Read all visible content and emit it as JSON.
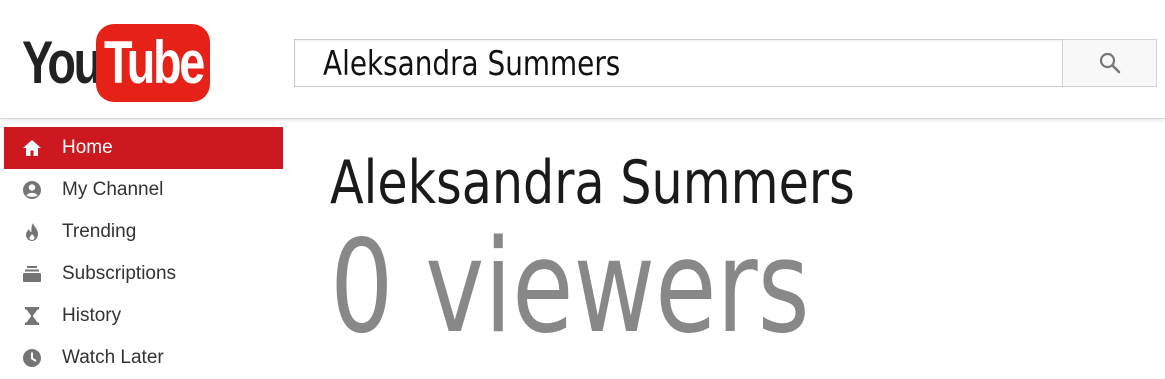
{
  "logo": {
    "you": "You",
    "tube": "Tube"
  },
  "search": {
    "value": "Aleksandra Summers",
    "icon": "search-icon"
  },
  "sidebar": {
    "items": [
      {
        "label": "Home",
        "icon": "home-icon",
        "active": true
      },
      {
        "label": "My Channel",
        "icon": "account-icon",
        "active": false
      },
      {
        "label": "Trending",
        "icon": "flame-icon",
        "active": false
      },
      {
        "label": "Subscriptions",
        "icon": "subscriptions-icon",
        "active": false
      },
      {
        "label": "History",
        "icon": "hourglass-icon",
        "active": false
      },
      {
        "label": "Watch Later",
        "icon": "clock-icon",
        "active": false
      }
    ]
  },
  "main": {
    "title": "Aleksandra Summers",
    "viewers": "0 viewers"
  },
  "colors": {
    "brand_red": "#e62117",
    "active_red": "#cc181e",
    "icon_gray": "#757575",
    "viewers_gray": "#888888"
  }
}
